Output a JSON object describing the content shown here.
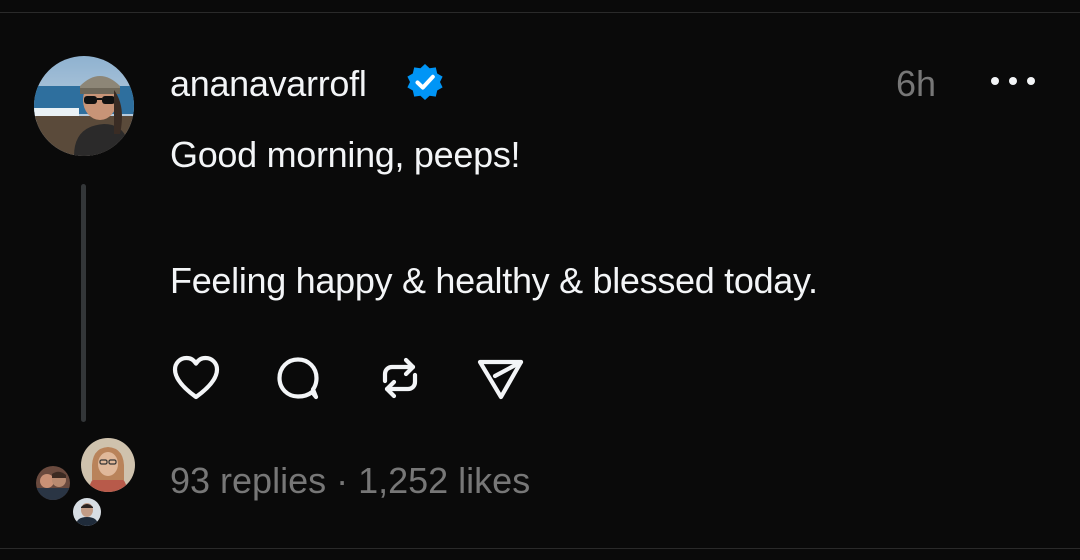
{
  "post": {
    "username": "ananavarrofl",
    "verified": true,
    "timestamp": "6h",
    "text_lines": [
      "Good morning, peeps!",
      "Feeling happy & healthy & blessed today."
    ]
  },
  "actions": [
    {
      "name": "like",
      "icon": "heart-icon"
    },
    {
      "name": "comment",
      "icon": "comment-bubble-icon"
    },
    {
      "name": "repost",
      "icon": "repost-icon"
    },
    {
      "name": "share",
      "icon": "send-icon"
    }
  ],
  "stats": {
    "replies": "93 replies",
    "separator": " · ",
    "likes": "1,252 likes"
  },
  "colors": {
    "background": "#0a0a0a",
    "primary_text": "#f3f5f7",
    "secondary_text": "#777777",
    "verified_badge": "#0095f6",
    "thread_line": "#333638"
  }
}
